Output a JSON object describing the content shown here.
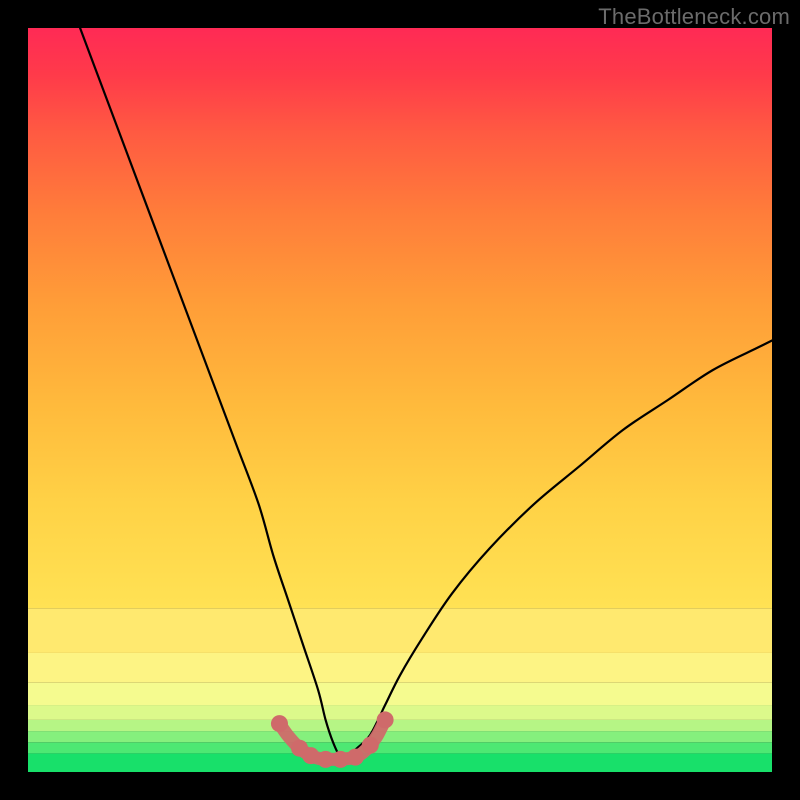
{
  "attribution": "TheBottleneck.com",
  "chart_data": {
    "type": "line",
    "title": "",
    "xlabel": "",
    "ylabel": "",
    "xlim": [
      0,
      100
    ],
    "ylim": [
      0,
      100
    ],
    "main_curve": {
      "name": "bottleneck-curve",
      "x": [
        7,
        10,
        13,
        16,
        19,
        22,
        25,
        28,
        31,
        33,
        35,
        37,
        39,
        40,
        41,
        42,
        43,
        44,
        46,
        48,
        50,
        53,
        57,
        62,
        68,
        74,
        80,
        86,
        92,
        98,
        100
      ],
      "y": [
        100,
        92,
        84,
        76,
        68,
        60,
        52,
        44,
        36,
        29,
        23,
        17,
        11,
        7,
        4,
        2,
        2,
        3,
        5,
        9,
        13,
        18,
        24,
        30,
        36,
        41,
        46,
        50,
        54,
        57,
        58
      ]
    },
    "highlight_segment": {
      "name": "optimal-range",
      "color": "#cf6a6a",
      "x": [
        33.8,
        35.0,
        36.5,
        38.0,
        39.2,
        40.0,
        41.0,
        42.0,
        43.0,
        44.0,
        45.0,
        46.0,
        47.0,
        48.0
      ],
      "y": [
        6.5,
        4.8,
        3.2,
        2.2,
        1.8,
        1.7,
        1.7,
        1.7,
        1.8,
        2.0,
        2.6,
        3.6,
        5.0,
        7.0
      ]
    },
    "highlight_dots": {
      "x": [
        33.8,
        36.5,
        38.0,
        40.0,
        42.0,
        44.0,
        46.0,
        48.0
      ],
      "y": [
        6.5,
        3.2,
        2.2,
        1.7,
        1.7,
        2.0,
        3.6,
        7.0
      ]
    },
    "bands": [
      {
        "y0": 0.0,
        "y1": 2.5,
        "color": "#18e06a"
      },
      {
        "y0": 2.5,
        "y1": 4.0,
        "color": "#4de873"
      },
      {
        "y0": 4.0,
        "y1": 5.5,
        "color": "#85f07d"
      },
      {
        "y0": 5.5,
        "y1": 7.0,
        "color": "#b6f585"
      },
      {
        "y0": 7.0,
        "y1": 9.0,
        "color": "#dcf98b"
      },
      {
        "y0": 9.0,
        "y1": 12.0,
        "color": "#f5fb8f"
      },
      {
        "y0": 12.0,
        "y1": 16.0,
        "color": "#fdf484"
      },
      {
        "y0": 16.0,
        "y1": 22.0,
        "color": "#ffe96f"
      }
    ],
    "upper_gradient": {
      "from_y": 22.0,
      "to_y": 100.0,
      "stops": [
        {
          "offset": 0.0,
          "color": "#ffe254"
        },
        {
          "offset": 0.18,
          "color": "#ffd246"
        },
        {
          "offset": 0.35,
          "color": "#ffba3c"
        },
        {
          "offset": 0.52,
          "color": "#ff9e38"
        },
        {
          "offset": 0.68,
          "color": "#ff7d3a"
        },
        {
          "offset": 0.82,
          "color": "#ff5a42"
        },
        {
          "offset": 0.92,
          "color": "#ff3a4a"
        },
        {
          "offset": 1.0,
          "color": "#ff2a55"
        }
      ]
    }
  }
}
